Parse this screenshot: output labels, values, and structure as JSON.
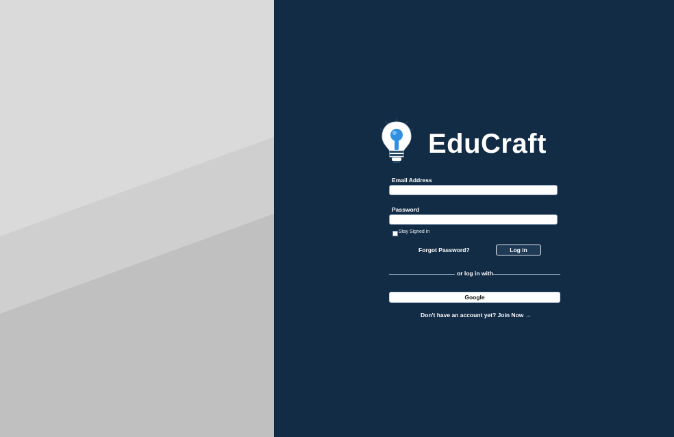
{
  "brand": {
    "name": "EduCraft",
    "logo_icon": "lightbulb-keyhole-icon"
  },
  "form": {
    "email_label": "Email Address",
    "email_value": "",
    "password_label": "Password",
    "password_value": "",
    "stay_signed_in_label": "Stay Signed in",
    "stay_signed_in_checked": false,
    "forgot_password": "Forgot Password?",
    "login_button": "Log in",
    "divider_text": "or log in with",
    "google_button": "Google",
    "signup_text": "Don't have an account yet? Join Now →"
  },
  "colors": {
    "panel_bg": "#132c45",
    "left_bg_light": "#d8d8d8",
    "left_bg_mid": "#cdcdcd",
    "left_bg_dark": "#bfbfbf",
    "bulb_blue": "#2f8fe0"
  }
}
